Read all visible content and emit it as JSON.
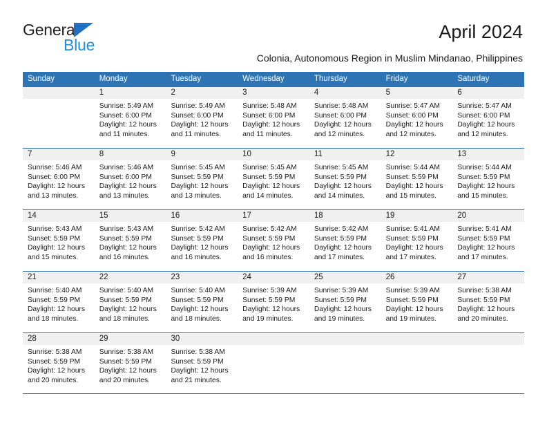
{
  "brand": {
    "name_line1": "General",
    "name_line2": "Blue",
    "color_dark": "#231f20",
    "color_blue": "#1f8fe0",
    "triangle_color": "#1f6fc4"
  },
  "header": {
    "title": "April 2024",
    "subtitle": "Colonia, Autonomous Region in Muslim Mindanao, Philippines"
  },
  "theme": {
    "header_row_bg": "#2e74b5",
    "header_row_text": "#ffffff",
    "daynum_band_bg": "#f0f0f0",
    "grid_line": "#2e74b5",
    "body_text": "#1a1a1a"
  },
  "calendar": {
    "day_headers": [
      "Sunday",
      "Monday",
      "Tuesday",
      "Wednesday",
      "Thursday",
      "Friday",
      "Saturday"
    ],
    "weeks": [
      [
        {
          "day": "",
          "lines": []
        },
        {
          "day": "1",
          "lines": [
            "Sunrise: 5:49 AM",
            "Sunset: 6:00 PM",
            "Daylight: 12 hours",
            "and 11 minutes."
          ]
        },
        {
          "day": "2",
          "lines": [
            "Sunrise: 5:49 AM",
            "Sunset: 6:00 PM",
            "Daylight: 12 hours",
            "and 11 minutes."
          ]
        },
        {
          "day": "3",
          "lines": [
            "Sunrise: 5:48 AM",
            "Sunset: 6:00 PM",
            "Daylight: 12 hours",
            "and 11 minutes."
          ]
        },
        {
          "day": "4",
          "lines": [
            "Sunrise: 5:48 AM",
            "Sunset: 6:00 PM",
            "Daylight: 12 hours",
            "and 12 minutes."
          ]
        },
        {
          "day": "5",
          "lines": [
            "Sunrise: 5:47 AM",
            "Sunset: 6:00 PM",
            "Daylight: 12 hours",
            "and 12 minutes."
          ]
        },
        {
          "day": "6",
          "lines": [
            "Sunrise: 5:47 AM",
            "Sunset: 6:00 PM",
            "Daylight: 12 hours",
            "and 12 minutes."
          ]
        }
      ],
      [
        {
          "day": "7",
          "lines": [
            "Sunrise: 5:46 AM",
            "Sunset: 6:00 PM",
            "Daylight: 12 hours",
            "and 13 minutes."
          ]
        },
        {
          "day": "8",
          "lines": [
            "Sunrise: 5:46 AM",
            "Sunset: 6:00 PM",
            "Daylight: 12 hours",
            "and 13 minutes."
          ]
        },
        {
          "day": "9",
          "lines": [
            "Sunrise: 5:45 AM",
            "Sunset: 5:59 PM",
            "Daylight: 12 hours",
            "and 13 minutes."
          ]
        },
        {
          "day": "10",
          "lines": [
            "Sunrise: 5:45 AM",
            "Sunset: 5:59 PM",
            "Daylight: 12 hours",
            "and 14 minutes."
          ]
        },
        {
          "day": "11",
          "lines": [
            "Sunrise: 5:45 AM",
            "Sunset: 5:59 PM",
            "Daylight: 12 hours",
            "and 14 minutes."
          ]
        },
        {
          "day": "12",
          "lines": [
            "Sunrise: 5:44 AM",
            "Sunset: 5:59 PM",
            "Daylight: 12 hours",
            "and 15 minutes."
          ]
        },
        {
          "day": "13",
          "lines": [
            "Sunrise: 5:44 AM",
            "Sunset: 5:59 PM",
            "Daylight: 12 hours",
            "and 15 minutes."
          ]
        }
      ],
      [
        {
          "day": "14",
          "lines": [
            "Sunrise: 5:43 AM",
            "Sunset: 5:59 PM",
            "Daylight: 12 hours",
            "and 15 minutes."
          ]
        },
        {
          "day": "15",
          "lines": [
            "Sunrise: 5:43 AM",
            "Sunset: 5:59 PM",
            "Daylight: 12 hours",
            "and 16 minutes."
          ]
        },
        {
          "day": "16",
          "lines": [
            "Sunrise: 5:42 AM",
            "Sunset: 5:59 PM",
            "Daylight: 12 hours",
            "and 16 minutes."
          ]
        },
        {
          "day": "17",
          "lines": [
            "Sunrise: 5:42 AM",
            "Sunset: 5:59 PM",
            "Daylight: 12 hours",
            "and 16 minutes."
          ]
        },
        {
          "day": "18",
          "lines": [
            "Sunrise: 5:42 AM",
            "Sunset: 5:59 PM",
            "Daylight: 12 hours",
            "and 17 minutes."
          ]
        },
        {
          "day": "19",
          "lines": [
            "Sunrise: 5:41 AM",
            "Sunset: 5:59 PM",
            "Daylight: 12 hours",
            "and 17 minutes."
          ]
        },
        {
          "day": "20",
          "lines": [
            "Sunrise: 5:41 AM",
            "Sunset: 5:59 PM",
            "Daylight: 12 hours",
            "and 17 minutes."
          ]
        }
      ],
      [
        {
          "day": "21",
          "lines": [
            "Sunrise: 5:40 AM",
            "Sunset: 5:59 PM",
            "Daylight: 12 hours",
            "and 18 minutes."
          ]
        },
        {
          "day": "22",
          "lines": [
            "Sunrise: 5:40 AM",
            "Sunset: 5:59 PM",
            "Daylight: 12 hours",
            "and 18 minutes."
          ]
        },
        {
          "day": "23",
          "lines": [
            "Sunrise: 5:40 AM",
            "Sunset: 5:59 PM",
            "Daylight: 12 hours",
            "and 18 minutes."
          ]
        },
        {
          "day": "24",
          "lines": [
            "Sunrise: 5:39 AM",
            "Sunset: 5:59 PM",
            "Daylight: 12 hours",
            "and 19 minutes."
          ]
        },
        {
          "day": "25",
          "lines": [
            "Sunrise: 5:39 AM",
            "Sunset: 5:59 PM",
            "Daylight: 12 hours",
            "and 19 minutes."
          ]
        },
        {
          "day": "26",
          "lines": [
            "Sunrise: 5:39 AM",
            "Sunset: 5:59 PM",
            "Daylight: 12 hours",
            "and 19 minutes."
          ]
        },
        {
          "day": "27",
          "lines": [
            "Sunrise: 5:38 AM",
            "Sunset: 5:59 PM",
            "Daylight: 12 hours",
            "and 20 minutes."
          ]
        }
      ],
      [
        {
          "day": "28",
          "lines": [
            "Sunrise: 5:38 AM",
            "Sunset: 5:59 PM",
            "Daylight: 12 hours",
            "and 20 minutes."
          ]
        },
        {
          "day": "29",
          "lines": [
            "Sunrise: 5:38 AM",
            "Sunset: 5:59 PM",
            "Daylight: 12 hours",
            "and 20 minutes."
          ]
        },
        {
          "day": "30",
          "lines": [
            "Sunrise: 5:38 AM",
            "Sunset: 5:59 PM",
            "Daylight: 12 hours",
            "and 21 minutes."
          ]
        },
        {
          "day": "",
          "lines": []
        },
        {
          "day": "",
          "lines": []
        },
        {
          "day": "",
          "lines": []
        },
        {
          "day": "",
          "lines": []
        }
      ]
    ]
  }
}
